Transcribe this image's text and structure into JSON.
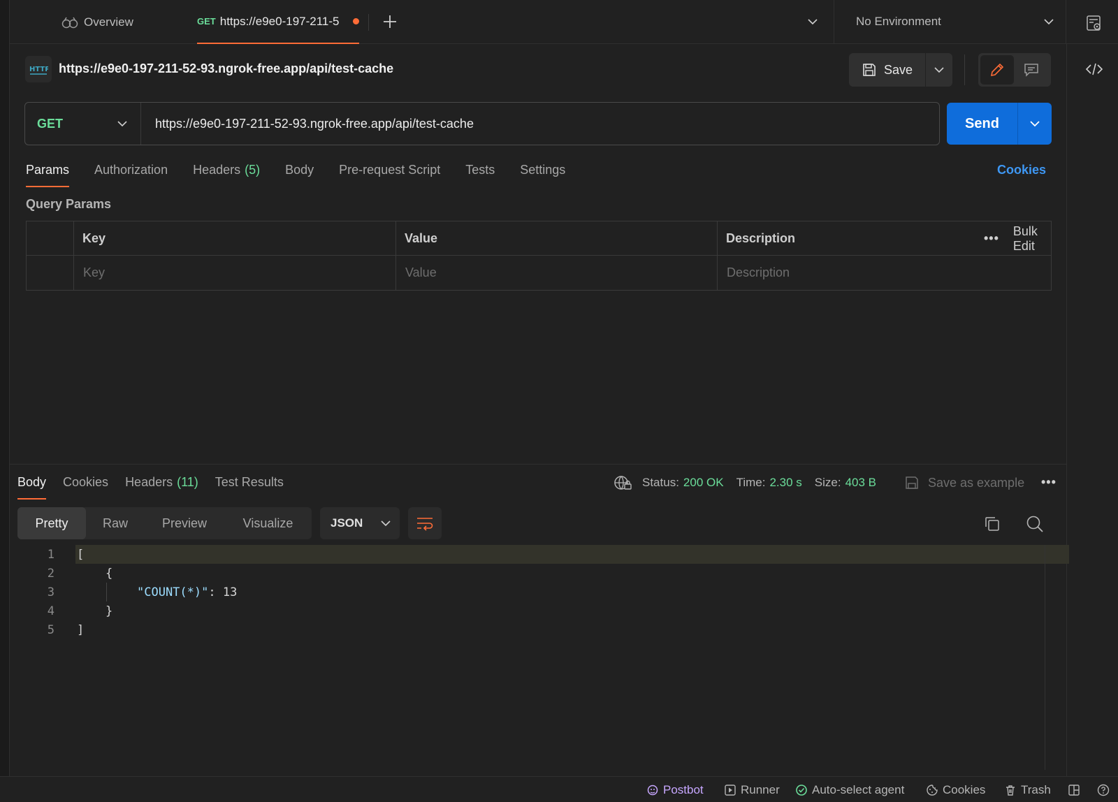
{
  "tabbar": {
    "overview_label": "Overview",
    "active_tab_method": "GET",
    "active_tab_url": "https://e9e0-197-211-5",
    "environment": "No Environment"
  },
  "request": {
    "title": "https://e9e0-197-211-52-93.ngrok-free.app/api/test-cache",
    "save_label": "Save",
    "method": "GET",
    "url": "https://e9e0-197-211-52-93.ngrok-free.app/api/test-cache",
    "send_label": "Send",
    "tabs": [
      {
        "label": "Params",
        "count": ""
      },
      {
        "label": "Authorization",
        "count": ""
      },
      {
        "label": "Headers",
        "count": "(5)"
      },
      {
        "label": "Body",
        "count": ""
      },
      {
        "label": "Pre-request Script",
        "count": ""
      },
      {
        "label": "Tests",
        "count": ""
      },
      {
        "label": "Settings",
        "count": ""
      }
    ],
    "cookies_label": "Cookies"
  },
  "params": {
    "section_title": "Query Params",
    "headers": {
      "key": "Key",
      "value": "Value",
      "description": "Description"
    },
    "bulk_edit": "Bulk Edit",
    "more": "•••",
    "placeholders": {
      "key": "Key",
      "value": "Value",
      "description": "Description"
    }
  },
  "response": {
    "tabs": [
      {
        "label": "Body",
        "count": ""
      },
      {
        "label": "Cookies",
        "count": ""
      },
      {
        "label": "Headers",
        "count": "(11)"
      },
      {
        "label": "Test Results",
        "count": ""
      }
    ],
    "status_label": "Status:",
    "status_value": "200 OK",
    "time_label": "Time:",
    "time_value": "2.30 s",
    "size_label": "Size:",
    "size_value": "403 B",
    "save_example": "Save as example",
    "more": "•••",
    "views": [
      "Pretty",
      "Raw",
      "Preview",
      "Visualize"
    ],
    "format": "JSON",
    "code_lines": [
      {
        "n": "1",
        "text": "["
      },
      {
        "n": "2",
        "text": "    {"
      },
      {
        "n": "3",
        "key": "\"COUNT(*)\"",
        "sep": ": ",
        "value": "13"
      },
      {
        "n": "4",
        "text": "    }"
      },
      {
        "n": "5",
        "text": "]"
      }
    ]
  },
  "statusbar": {
    "postbot": "Postbot",
    "runner": "Runner",
    "agent": "Auto-select agent",
    "cookies": "Cookies",
    "trash": "Trash"
  },
  "colors": {
    "accent": "#ff6c37",
    "send": "#0f6ddb",
    "get": "#6bdd9a",
    "link": "#3e97f3",
    "postbot": "#c7a7ff"
  }
}
